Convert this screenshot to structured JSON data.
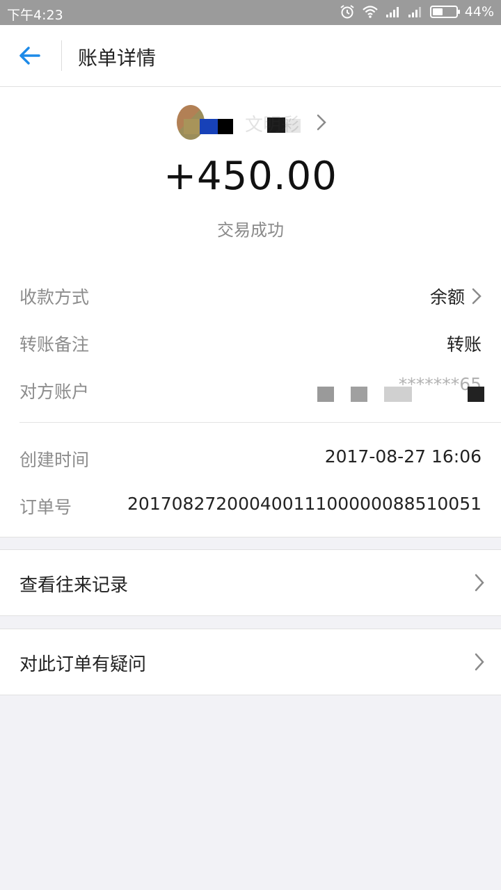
{
  "status_bar": {
    "time": "下午4:23",
    "battery": "44%",
    "battery_level": 0.44
  },
  "header": {
    "title": "账单详情"
  },
  "summary": {
    "payee_name": "文明彩",
    "amount": "+450.00",
    "status": "交易成功"
  },
  "details": {
    "rows": [
      {
        "label": "收款方式",
        "value": "余额"
      },
      {
        "label": "转账备注",
        "value": "转账"
      },
      {
        "label": "对方账户",
        "value": "*******65"
      },
      {
        "label": "创建时间",
        "value": "2017-08-27 16:06"
      },
      {
        "label": "订单号",
        "value": "20170827200040011100000088510051"
      }
    ]
  },
  "actions": {
    "history": "查看往来记录",
    "question": "对此订单有疑问"
  },
  "colors": {
    "accent": "#1d8ae8",
    "statusbar": "#9b9b9b",
    "background": "#f2f2f6"
  }
}
